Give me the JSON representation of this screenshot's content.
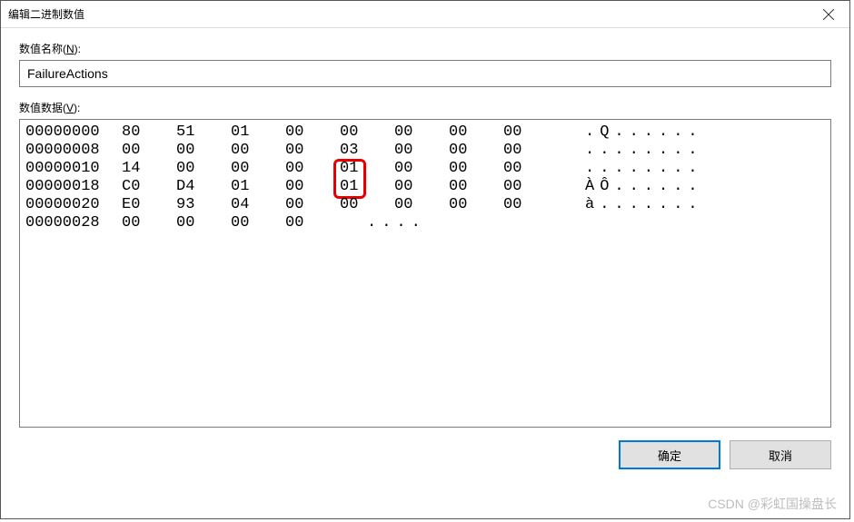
{
  "title": "编辑二进制数值",
  "labels": {
    "value_name_pre": "数值名称(",
    "value_name_u": "N",
    "value_name_post": "):",
    "value_data_pre": "数值数据(",
    "value_data_u": "V",
    "value_data_post": "):"
  },
  "value_name": "FailureActions",
  "hex": {
    "rows": [
      {
        "offset": "00000000",
        "bytes": [
          "80",
          "51",
          "01",
          "00",
          "00",
          "00",
          "00",
          "00"
        ],
        "ascii": ".Q......"
      },
      {
        "offset": "00000008",
        "bytes": [
          "00",
          "00",
          "00",
          "00",
          "03",
          "00",
          "00",
          "00"
        ],
        "ascii": "........"
      },
      {
        "offset": "00000010",
        "bytes": [
          "14",
          "00",
          "00",
          "00",
          "01",
          "00",
          "00",
          "00"
        ],
        "ascii": "........"
      },
      {
        "offset": "00000018",
        "bytes": [
          "C0",
          "D4",
          "01",
          "00",
          "01",
          "00",
          "00",
          "00"
        ],
        "ascii": "ÀÔ......"
      },
      {
        "offset": "00000020",
        "bytes": [
          "E0",
          "93",
          "04",
          "00",
          "00",
          "00",
          "00",
          "00"
        ],
        "ascii": "à......."
      },
      {
        "offset": "00000028",
        "bytes": [
          "00",
          "00",
          "00",
          "00"
        ],
        "ascii": "...."
      }
    ],
    "highlight": {
      "row_start": 2,
      "row_end": 3,
      "col": 4
    }
  },
  "buttons": {
    "ok": "确定",
    "cancel": "取消"
  },
  "watermark": "CSDN @彩虹国操盘长"
}
